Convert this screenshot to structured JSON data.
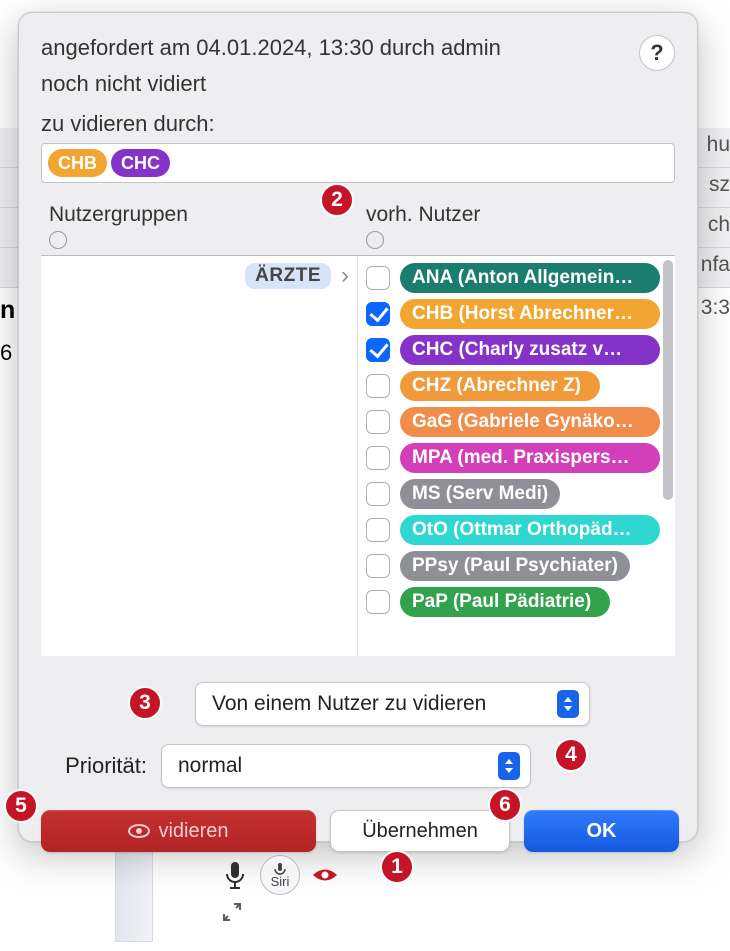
{
  "header": {
    "requested_line": "angefordert am 04.01.2024, 13:30 durch admin",
    "status_line": "noch nicht vidiert",
    "assign_label": "zu vidieren durch:"
  },
  "selected_pills": [
    {
      "label": "CHB",
      "color": "#f2a531"
    },
    {
      "label": "CHC",
      "color": "#8532c9"
    }
  ],
  "groups": {
    "heading": "Nutzergruppen",
    "items": [
      {
        "label": "ÄRZTE"
      }
    ]
  },
  "users": {
    "heading": "vorh. Nutzer",
    "items": [
      {
        "label": "ANA (Anton Allgemein…",
        "color": "#1a7d6f",
        "checked": false
      },
      {
        "label": "CHB (Horst Abrechner…",
        "color": "#f2a531",
        "checked": true
      },
      {
        "label": "CHC (Charly zusatz v…",
        "color": "#8532c9",
        "checked": true
      },
      {
        "label": "CHZ (Abrechner Z)",
        "color": "#f09a3a",
        "checked": false
      },
      {
        "label": "GaG (Gabriele Gynäko…",
        "color": "#f28c4b",
        "checked": false
      },
      {
        "label": "MPA (med. Praxispers…",
        "color": "#d33fbb",
        "checked": false
      },
      {
        "label": "MS (Serv Medi)",
        "color": "#8f8f97",
        "checked": false
      },
      {
        "label": "OtO (Ottmar Orthopäd…",
        "color": "#2fd7d1",
        "checked": false
      },
      {
        "label": "PPsy (Paul Psychiater)",
        "color": "#8f8f97",
        "checked": false
      },
      {
        "label": "PaP (Paul Pädiatrie)",
        "color": "#33a24c",
        "checked": false
      }
    ]
  },
  "mode_select": {
    "value": "Von einem Nutzer zu vidieren"
  },
  "priority": {
    "label": "Priorität:",
    "value": "normal"
  },
  "buttons": {
    "vidieren": "vidieren",
    "uebernehmen": "Übernehmen",
    "ok": "OK"
  },
  "annotations": {
    "b1": "1",
    "b2": "2",
    "b3": "3",
    "b4": "4",
    "b5": "5",
    "b6": "6"
  },
  "toolbar": {
    "siri_label": "Siri"
  },
  "background": {
    "frag1": "hu",
    "frag2": "sz",
    "frag3": "ch",
    "frag4": "nfa",
    "time": "3:3",
    "left_n": "n",
    "left_6": "6"
  }
}
